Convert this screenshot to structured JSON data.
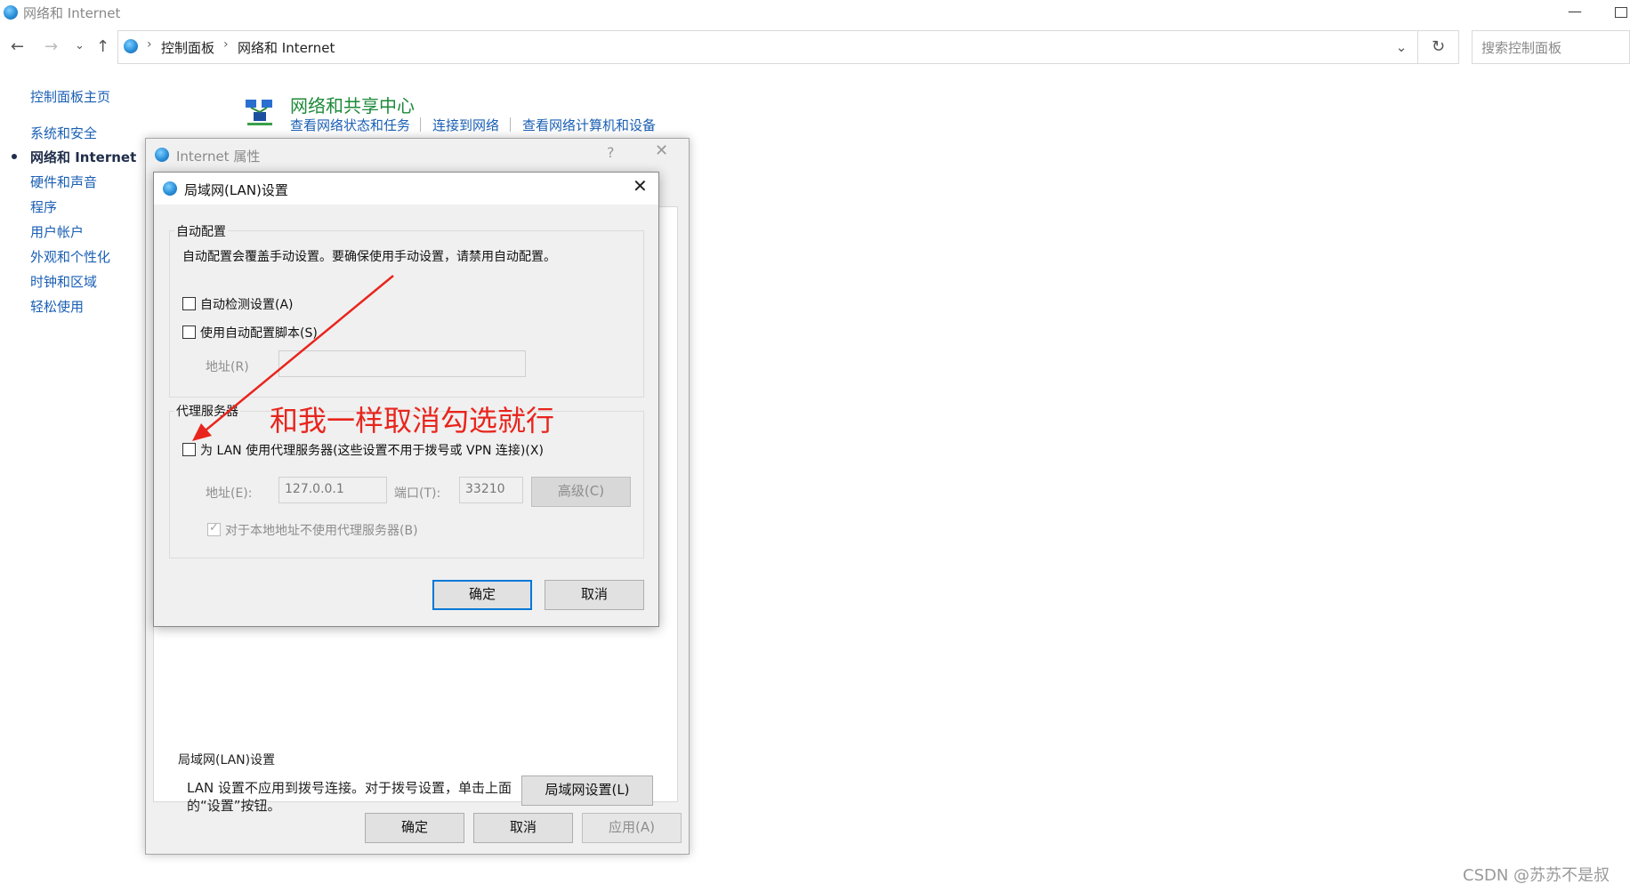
{
  "window": {
    "title": "网络和 Internet"
  },
  "nav": {
    "breadcrumb": [
      "控制面板",
      "网络和 Internet"
    ],
    "search_placeholder": "搜索控制面板"
  },
  "sidebar": {
    "items": [
      {
        "label": "控制面板主页",
        "active": false
      },
      {
        "label": "系统和安全",
        "active": false
      },
      {
        "label": "网络和 Internet",
        "active": true
      },
      {
        "label": "硬件和声音",
        "active": false
      },
      {
        "label": "程序",
        "active": false
      },
      {
        "label": "用户帐户",
        "active": false
      },
      {
        "label": "外观和个性化",
        "active": false
      },
      {
        "label": "时钟和区域",
        "active": false
      },
      {
        "label": "轻松使用",
        "active": false
      }
    ]
  },
  "network_center": {
    "title": "网络和共享中心",
    "links": [
      "查看网络状态和任务",
      "连接到网络",
      "查看网络计算机和设备"
    ]
  },
  "internet_properties": {
    "title": "Internet 属性",
    "lan_group_label": "局域网(LAN)设置",
    "lan_note": "LAN 设置不应用到拨号连接。对于拨号设置，单击上面的“设置”按钮。",
    "lan_settings_button": "局域网设置(L)",
    "ok": "确定",
    "cancel": "取消",
    "apply": "应用(A)"
  },
  "lan_dialog": {
    "title": "局域网(LAN)设置",
    "auto_config": {
      "group_label": "自动配置",
      "description": "自动配置会覆盖手动设置。要确保使用手动设置，请禁用自动配置。",
      "auto_detect_label": "自动检测设置(A)",
      "auto_detect_checked": false,
      "use_script_label": "使用自动配置脚本(S)",
      "use_script_checked": false,
      "address_label": "地址(R)",
      "address_value": ""
    },
    "proxy": {
      "group_label": "代理服务器",
      "use_proxy_label": "为 LAN 使用代理服务器(这些设置不用于拨号或 VPN 连接)(X)",
      "use_proxy_checked": false,
      "address_label": "地址(E):",
      "address_value": "127.0.0.1",
      "port_label": "端口(T):",
      "port_value": "33210",
      "advanced_button": "高级(C)",
      "bypass_local_label": "对于本地地址不使用代理服务器(B)",
      "bypass_local_checked": true
    },
    "ok": "确定",
    "cancel": "取消"
  },
  "annotation": {
    "text": "和我一样取消勾选就行",
    "color": "#e8251d"
  },
  "watermark": "CSDN @苏苏不是叔"
}
